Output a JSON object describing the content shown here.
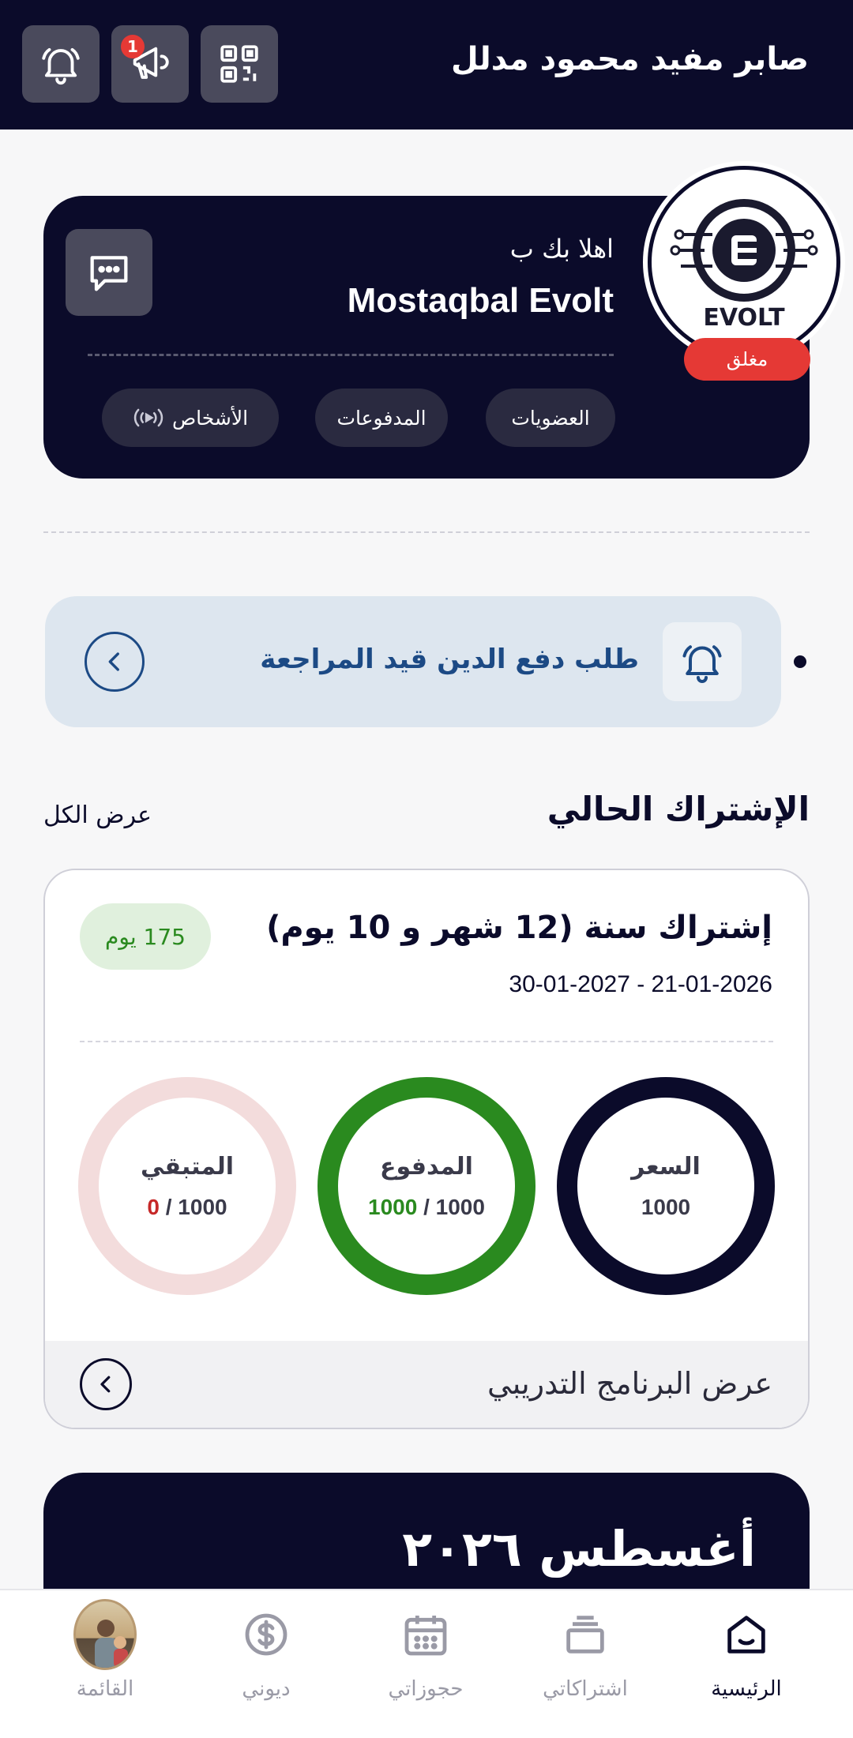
{
  "header": {
    "user_name": "صابر مفيد محمود مدلل",
    "notification_badge": "1"
  },
  "welcome": {
    "hello": "اهلا بك ب",
    "gym_name": "Mostaqbal Evolt",
    "status": "مغلق",
    "logo_text": "EVOLT",
    "pills": {
      "memberships": "العضويات",
      "payments": "المدفوعات",
      "people": "الأشخاص"
    }
  },
  "notice": {
    "text": "طلب دفع الدين قيد المراجعة"
  },
  "current_subscription": {
    "section_title": "الإشتراك الحالي",
    "view_all": "عرض الكل",
    "title": "إشتراك سنة (12 شهر و 10 يوم)",
    "dates": "30-01-2027 - 21-01-2026",
    "days_left": "175 يوم",
    "price": {
      "label": "السعر",
      "value": "1000"
    },
    "paid": {
      "label": "المدفوع",
      "amount": "1000",
      "total": " / 1000"
    },
    "remaining": {
      "label": "المتبقي",
      "amount": "0",
      "total": " / 1000"
    },
    "footer": "عرض البرنامج التدريبي"
  },
  "calendar": {
    "month": "أغسطس ٢٠٢٦"
  },
  "bottom_nav": {
    "home": "الرئيسية",
    "subscriptions": "اشتراكاتي",
    "bookings": "حجوزاتي",
    "debts": "ديوني",
    "menu": "القائمة"
  },
  "colors": {
    "navy": "#0b0b2a",
    "green": "#2a8a1f",
    "red": "#e53935",
    "remaining_ring": "#f3dcdc"
  }
}
